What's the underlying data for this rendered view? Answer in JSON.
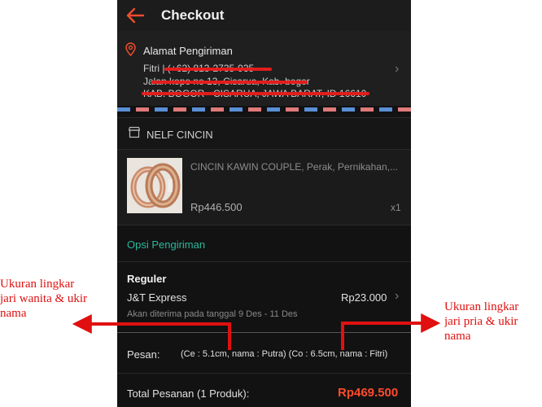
{
  "header": {
    "title": "Checkout"
  },
  "address": {
    "title": "Alamat Pengiriman",
    "line1": "Fitri | (+62) 813-2735-935",
    "line2": "Jalan kopo no 13, Cisarua, Kab. bogor",
    "line3": "KAB. BOGOR - CISARUA, JAWA BARAT, ID 16610"
  },
  "shop": {
    "name": "NELF CINCIN"
  },
  "product": {
    "name": "CINCIN KAWIN COUPLE, Perak, Pernikahan,...",
    "price": "Rp446.500",
    "qty": "x1"
  },
  "shipping": {
    "section_label": "Opsi Pengiriman",
    "service": "Reguler",
    "courier": "J&T Express",
    "price": "Rp23.000",
    "eta": "Akan diterima pada tanggal 9 Des - 11 Des"
  },
  "message": {
    "label": "Pesan:",
    "value": "(Ce : 5.1cm, nama : Putra) (Co : 6.5cm, nama : Fitri)"
  },
  "total": {
    "label": "Total Pesanan (1 Produk):",
    "value": "Rp469.500"
  },
  "annotations": {
    "left": "Ukuran lingkar\njari wanita & ukir\nnama",
    "right": "Ukuran lingkar\njari pria & ukir\nnama"
  },
  "colors": {
    "accent": "#ff4b2b",
    "teal": "#2bb89c",
    "annotation": "#e01010",
    "background": "#121212"
  },
  "icons": [
    "back-arrow-icon",
    "location-pin-icon",
    "chevron-right-icon",
    "store-icon"
  ]
}
